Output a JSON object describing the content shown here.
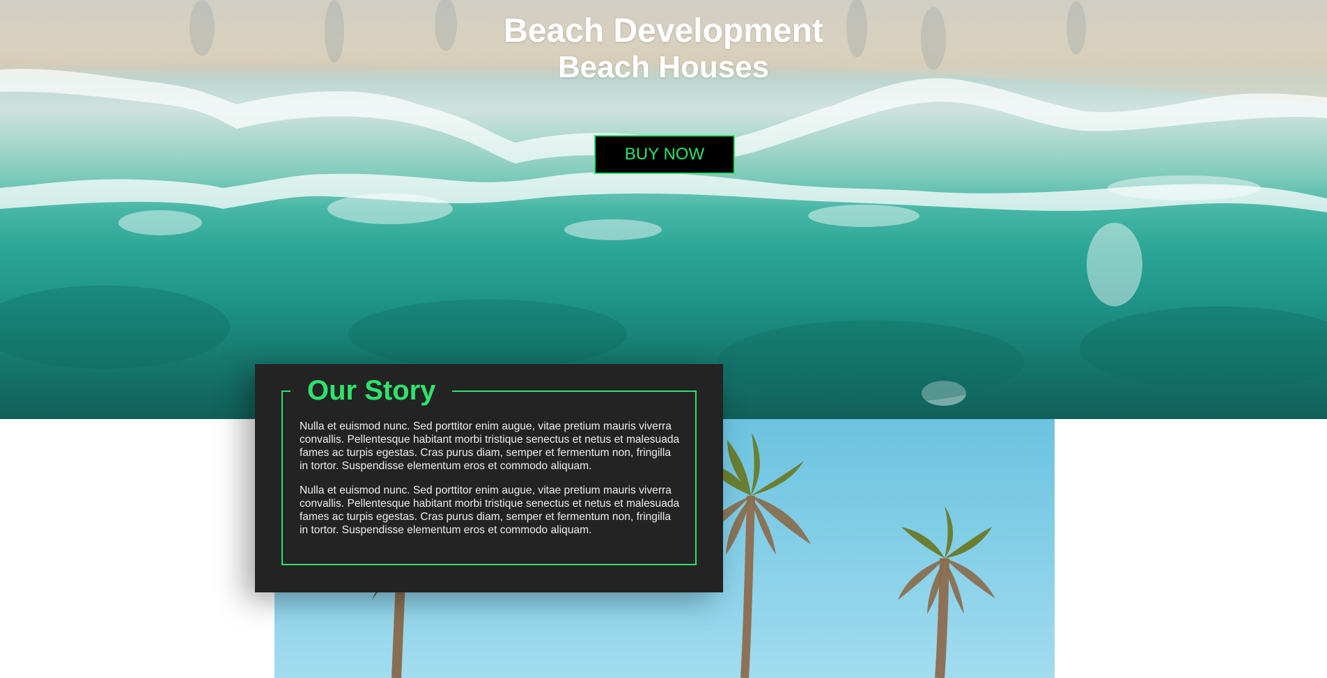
{
  "hero": {
    "title": "Beach Development",
    "subtitle": "Beach Houses",
    "cta_label": "BUY NOW"
  },
  "story": {
    "title": "Our Story",
    "paragraphs": [
      "Nulla et euismod nunc. Sed porttitor enim augue, vitae pretium mauris viverra convallis. Pellentesque habitant morbi tristique senectus et netus et malesuada fames ac turpis egestas. Cras purus diam, semper et fermentum non, fringilla in tortor. Suspendisse elementum eros et commodo aliquam.",
      "Nulla et euismod nunc. Sed porttitor enim augue, vitae pretium mauris viverra convallis. Pellentesque habitant morbi tristique senectus et netus et malesuada fames ac turpis egestas. Cras purus diam, semper et fermentum non, fringilla in tortor. Suspendisse elementum eros et commodo aliquam."
    ]
  },
  "colors": {
    "accent": "#2ee36c",
    "card_background": "#232323",
    "button_background": "#000000",
    "ocean": "#1e9488",
    "sky": "#84cfe8"
  },
  "images": {
    "hero": "aerial-beach-waves-photo",
    "story": "palm-trees-sky-photo"
  }
}
